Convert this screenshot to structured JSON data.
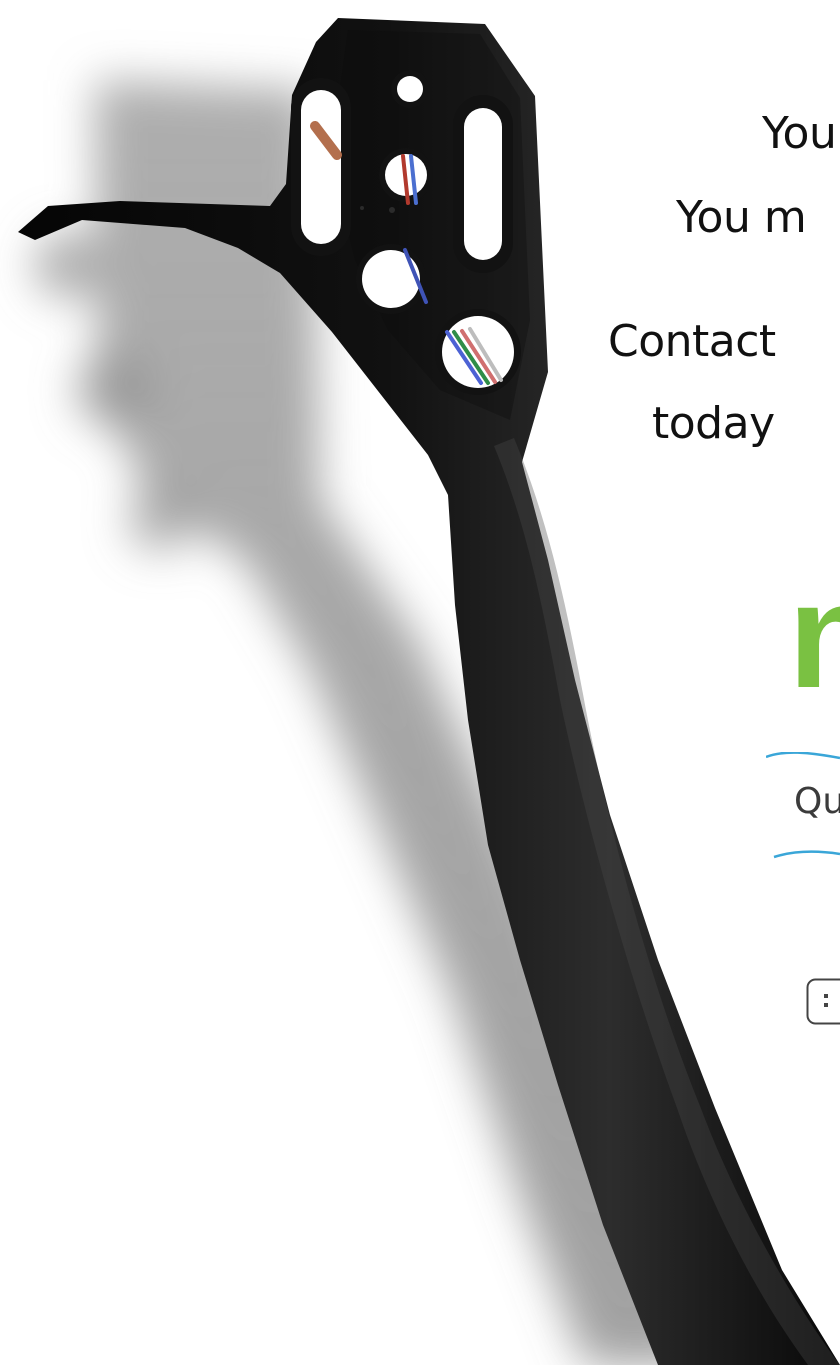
{
  "text": {
    "line1": "You",
    "line2": "You m",
    "line3": "Contact",
    "line4": "today"
  },
  "logos": {
    "n_logo": "n",
    "q_logo": "Qu"
  },
  "icons": {
    "drive": "drive-icon"
  },
  "colors": {
    "logo_green": "#7ac142",
    "body_text": "#111111",
    "swoosh_blue": "#3aa6d8"
  }
}
